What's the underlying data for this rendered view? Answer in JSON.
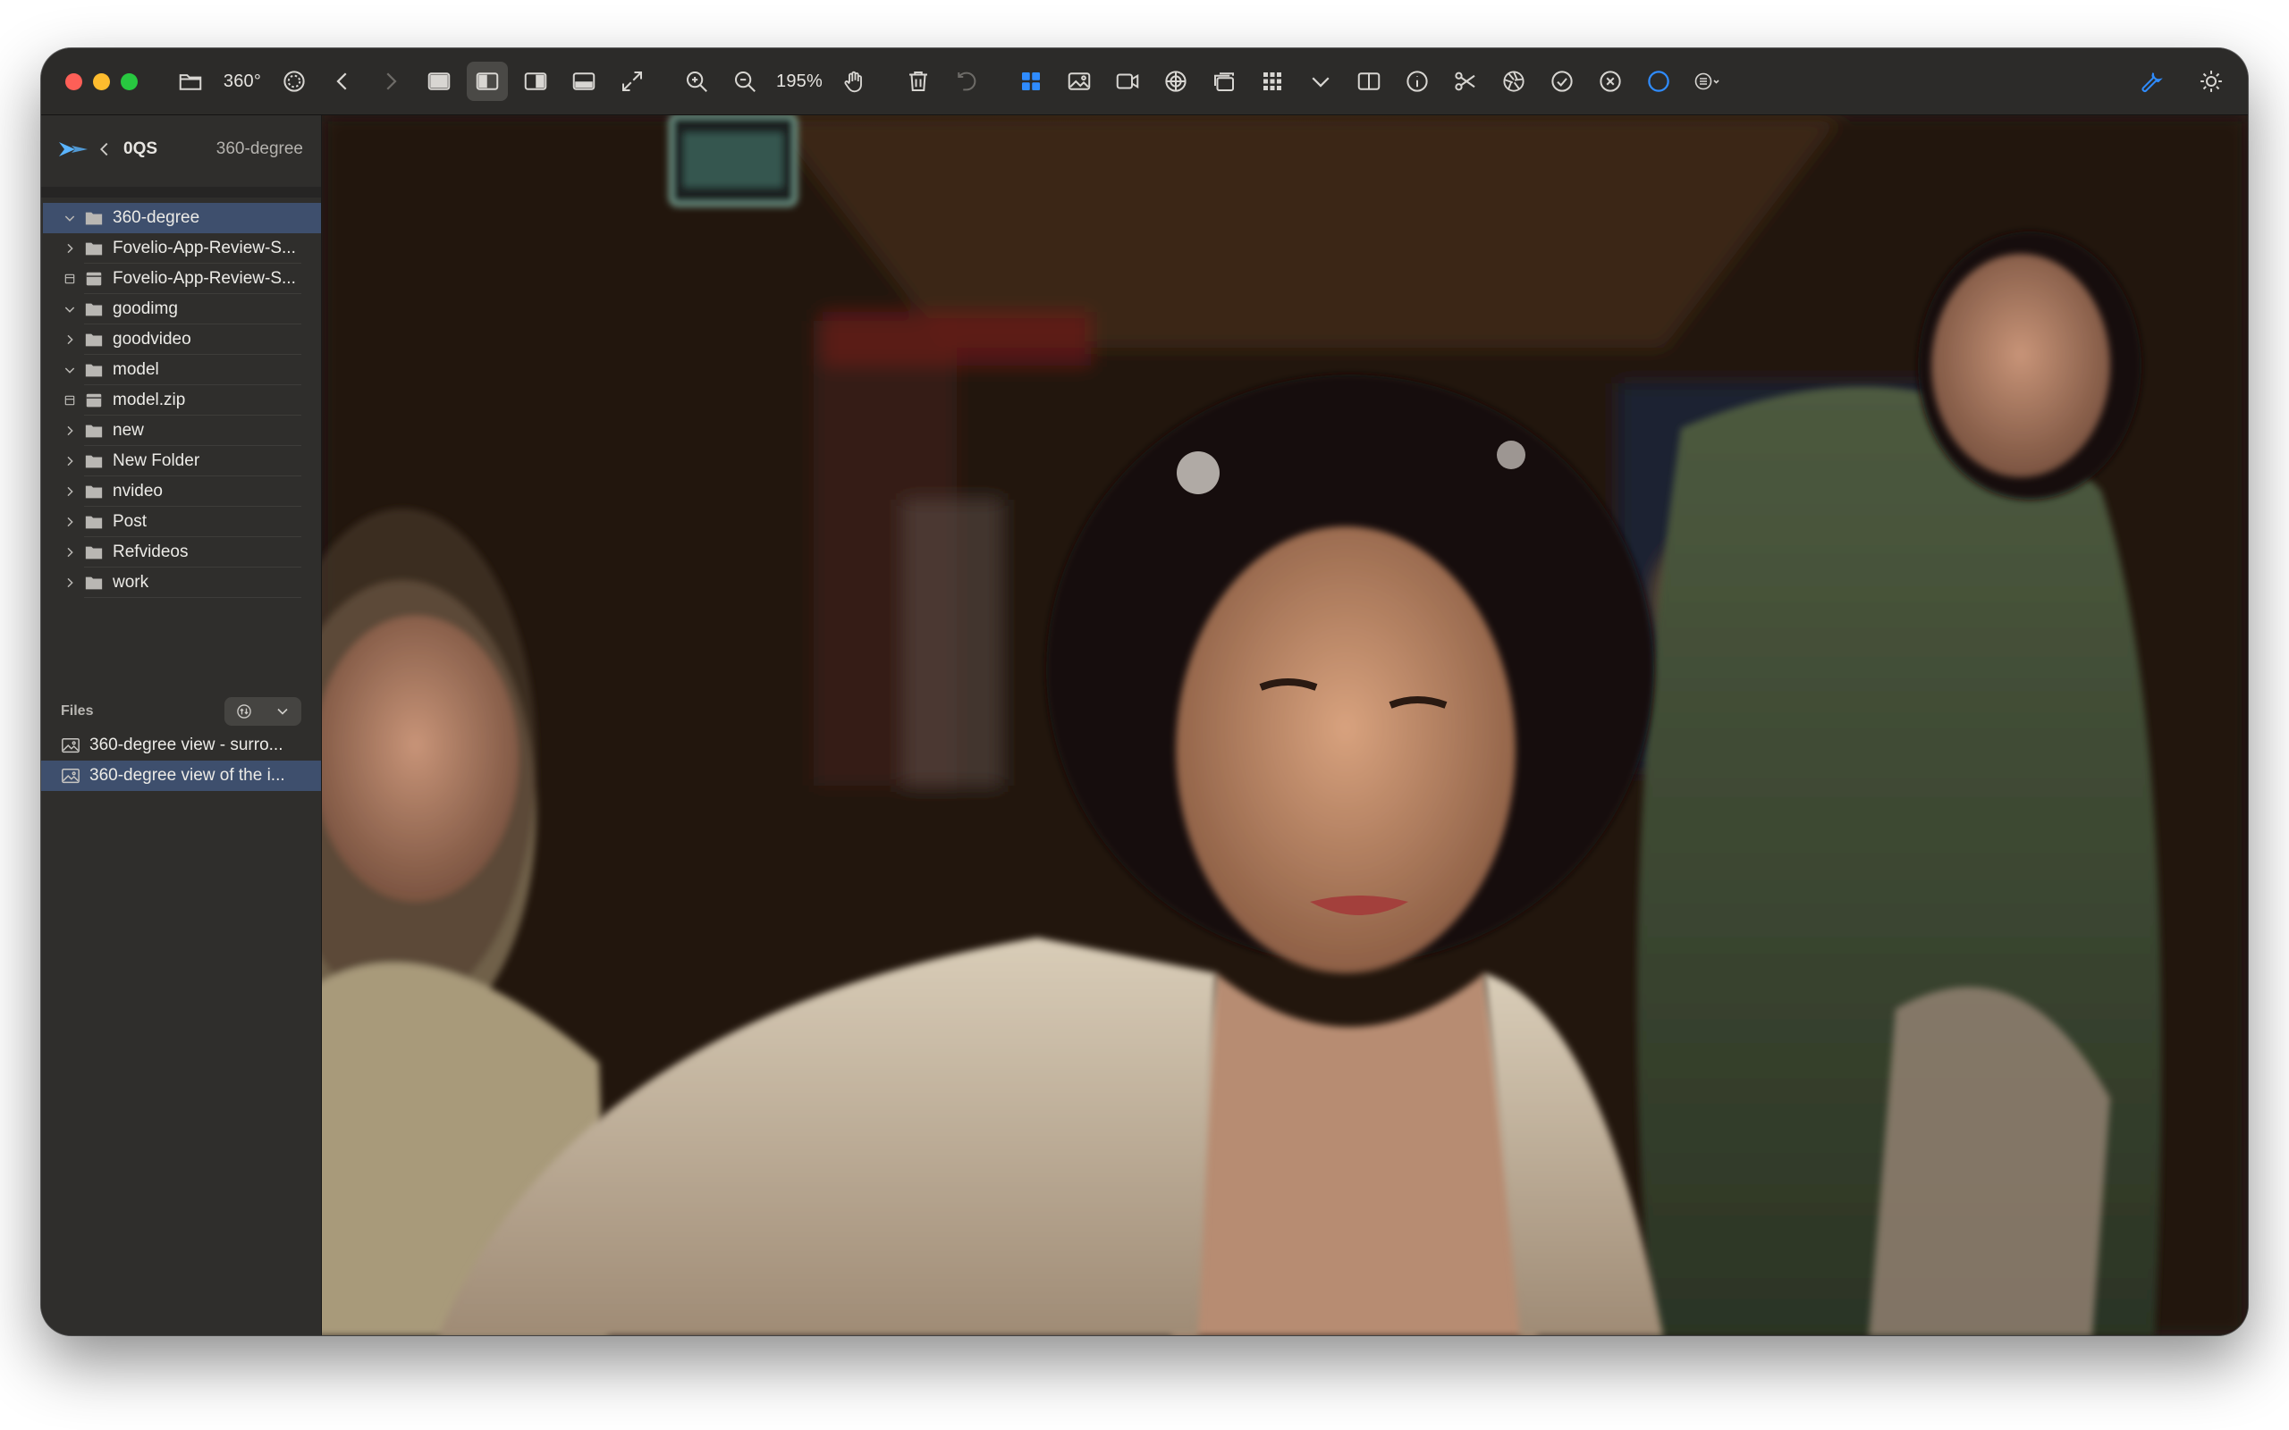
{
  "toolbar": {
    "degree_label": "360°",
    "zoom_level": "195%",
    "left_icons": [
      "folder-icon",
      "degree-label",
      "target-icon",
      "chevron-left-icon",
      "chevron-right-icon",
      "single-view-icon",
      "sidebar-view-icon",
      "right-panel-view-icon",
      "bottom-panel-view-icon",
      "expand-icon",
      "zoom-in-icon",
      "zoom-out-icon",
      "hand-icon",
      "trash-icon",
      "undo-icon",
      "grid-icon",
      "image-icon",
      "video-icon",
      "sync-icon",
      "stack-icon",
      "dots-grid-icon",
      "chevron-down-icon",
      "split-view-icon",
      "info-icon",
      "scissors-icon",
      "aperture-icon",
      "check-circle-icon",
      "x-circle-icon",
      "circle-icon",
      "list-menu-icon"
    ],
    "right_icons": [
      "wrench-icon",
      "sun-icon"
    ],
    "accent_color": "#2f8cff"
  },
  "sidebar": {
    "root": "0QS",
    "current": "360-degree",
    "tree": [
      {
        "label": "360-degree",
        "type": "folder",
        "chevron": "down",
        "selected": true
      },
      {
        "label": "Fovelio-App-Review-S...",
        "type": "folder",
        "chevron": "right"
      },
      {
        "label": "Fovelio-App-Review-S...",
        "type": "archive",
        "chevron": "none"
      },
      {
        "label": "goodimg",
        "type": "folder",
        "chevron": "down"
      },
      {
        "label": "goodvideo",
        "type": "folder",
        "chevron": "right"
      },
      {
        "label": "model",
        "type": "folder",
        "chevron": "down"
      },
      {
        "label": "model.zip",
        "type": "archive",
        "chevron": "none"
      },
      {
        "label": "new",
        "type": "folder",
        "chevron": "right"
      },
      {
        "label": "New Folder",
        "type": "folder",
        "chevron": "right"
      },
      {
        "label": "nvideo",
        "type": "folder",
        "chevron": "right"
      },
      {
        "label": "Post",
        "type": "folder",
        "chevron": "right"
      },
      {
        "label": "Refvideos",
        "type": "folder",
        "chevron": "right"
      },
      {
        "label": "work",
        "type": "folder",
        "chevron": "right"
      }
    ],
    "files_heading": "Files",
    "files": [
      {
        "label": "360-degree view - surro...",
        "selected": false
      },
      {
        "label": "360-degree view of the i...",
        "selected": true
      }
    ],
    "selection_color": "#3e4f6d"
  }
}
